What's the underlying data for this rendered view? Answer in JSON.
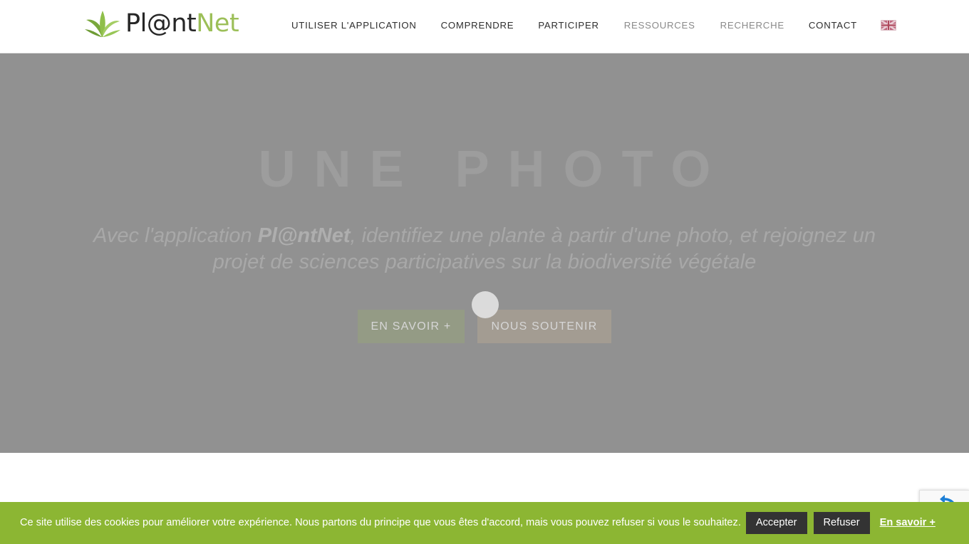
{
  "header": {
    "logo": {
      "icon": "leaf-icon",
      "text_dark": "Pl@nt",
      "text_green": "Net",
      "green_hex": "#9cbf58"
    },
    "nav": [
      {
        "label": "UTILISER L'APPLICATION",
        "muted": false
      },
      {
        "label": "COMPRENDRE",
        "muted": false
      },
      {
        "label": "PARTICIPER",
        "muted": false
      },
      {
        "label": "RESSOURCES",
        "muted": true
      },
      {
        "label": "RECHERCHE",
        "muted": true
      },
      {
        "label": "CONTACT",
        "muted": false
      }
    ],
    "language_switcher": {
      "icon": "uk-flag-icon",
      "title": "English"
    }
  },
  "hero": {
    "title": "UNE PHOTO",
    "subtitle_prefix": "Avec l'application ",
    "subtitle_brand": "Pl@ntNet",
    "subtitle_suffix": ", identifiez une plante à partir d'une photo, et rejoignez un projet de sciences participatives sur la biodiversité végétale",
    "spinner": "loading-spinner",
    "buttons": [
      {
        "label": "EN SAVOIR +",
        "color": "#949b85"
      },
      {
        "label": "NOUS SOUTENIR",
        "color": "#a39c92"
      }
    ],
    "background_hex": "#919191"
  },
  "recaptcha": {
    "icon": "recaptcha-icon"
  },
  "cookies": {
    "message": "Ce site utilise des cookies pour améliorer votre expérience. Nous partons du principe que vous êtes d'accord, mais vous pouvez refuser si vous le souhaitez.",
    "accept_label": "Accepter",
    "refuse_label": "Refuser",
    "more_label": "En savoir +",
    "background_hex": "#8cb633"
  }
}
